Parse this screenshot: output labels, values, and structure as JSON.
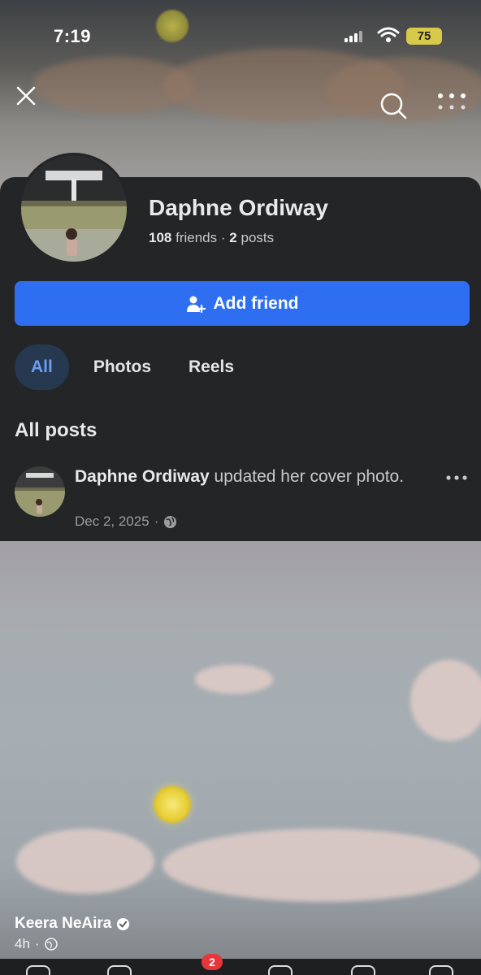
{
  "status_bar": {
    "time": "7:19",
    "battery": "75"
  },
  "header": {
    "close_icon": "close-icon",
    "search_icon": "search-icon",
    "more_icon": "more-icon"
  },
  "profile": {
    "name": "Daphne Ordiway",
    "friends_count": "108",
    "friends_label": "friends",
    "separator": "·",
    "posts_count": "2",
    "posts_label": "posts",
    "add_friend_label": "Add friend"
  },
  "tabs": [
    {
      "label": "All",
      "active": true
    },
    {
      "label": "Photos",
      "active": false
    },
    {
      "label": "Reels",
      "active": false
    }
  ],
  "posts_section": {
    "title": "All posts",
    "post": {
      "author": "Daphne Ordiway",
      "action": "updated her cover photo.",
      "date": "Dec 2, 2025",
      "separator": "·",
      "privacy_icon": "globe-icon"
    }
  },
  "story_overlay": {
    "user": "Keera NeAira",
    "verified_icon": "verified-badge-icon",
    "time": "4h",
    "separator": "·"
  },
  "tabbar": {
    "notification_count": "2"
  },
  "colors": {
    "accent": "#2e6ff2",
    "card_bg": "#242526",
    "active_tab_bg": "#263951",
    "active_tab_text": "#6b9ef0"
  }
}
